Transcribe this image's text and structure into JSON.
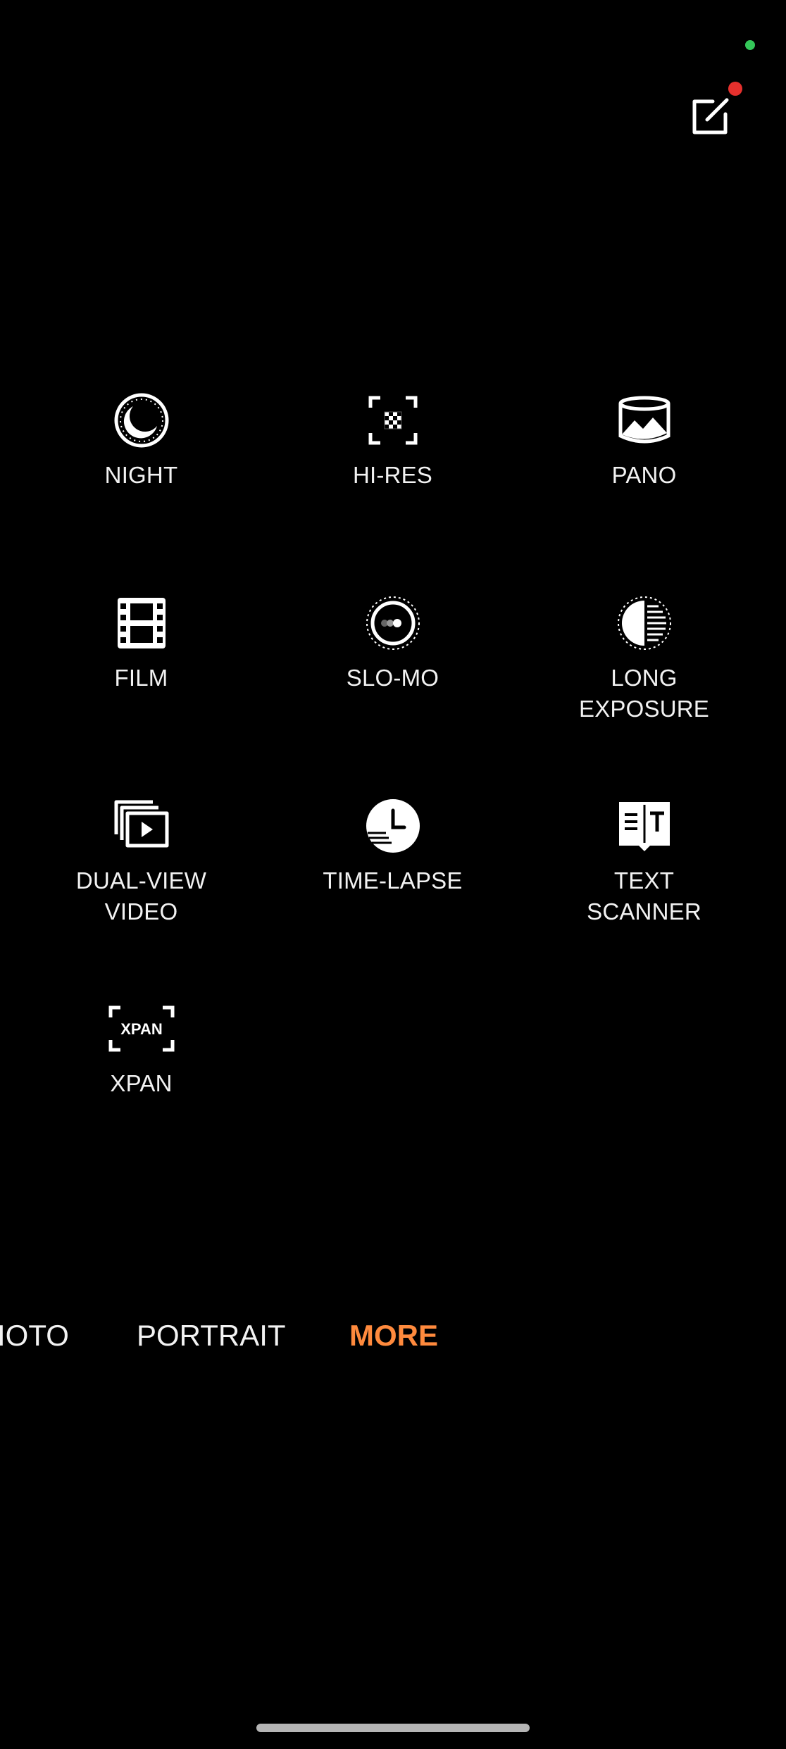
{
  "colors": {
    "background": "#000000",
    "text": "#f2f2f2",
    "accent": "#ff8a3d",
    "privacy_indicator": "#34c759",
    "notification_dot": "#e5302d",
    "home_indicator": "#b5b5b5"
  },
  "top_bar": {
    "edit_icon": "edit-square-icon"
  },
  "modes": [
    {
      "label": "NIGHT",
      "icon": "night-moon-icon"
    },
    {
      "label": "HI-RES",
      "icon": "hi-res-grid-icon"
    },
    {
      "label": "PANO",
      "icon": "panorama-icon"
    },
    {
      "label": "FILM",
      "icon": "film-strip-icon"
    },
    {
      "label": "SLO-MO",
      "icon": "slow-motion-icon"
    },
    {
      "label": "LONG\nEXPOSURE",
      "icon": "long-exposure-icon"
    },
    {
      "label": "DUAL-VIEW\nVIDEO",
      "icon": "dual-view-video-icon"
    },
    {
      "label": "TIME-LAPSE",
      "icon": "time-lapse-clock-icon"
    },
    {
      "label": "TEXT\nSCANNER",
      "icon": "text-scanner-icon"
    },
    {
      "label": "XPAN",
      "icon": "xpan-frame-icon",
      "icon_text": "XPAN"
    }
  ],
  "mode_bar": {
    "tabs": [
      {
        "label": "PHOTO",
        "visible_text": "IOTO",
        "active": false
      },
      {
        "label": "PORTRAIT",
        "visible_text": "PORTRAIT",
        "active": false
      },
      {
        "label": "MORE",
        "visible_text": "MORE",
        "active": true
      }
    ]
  }
}
